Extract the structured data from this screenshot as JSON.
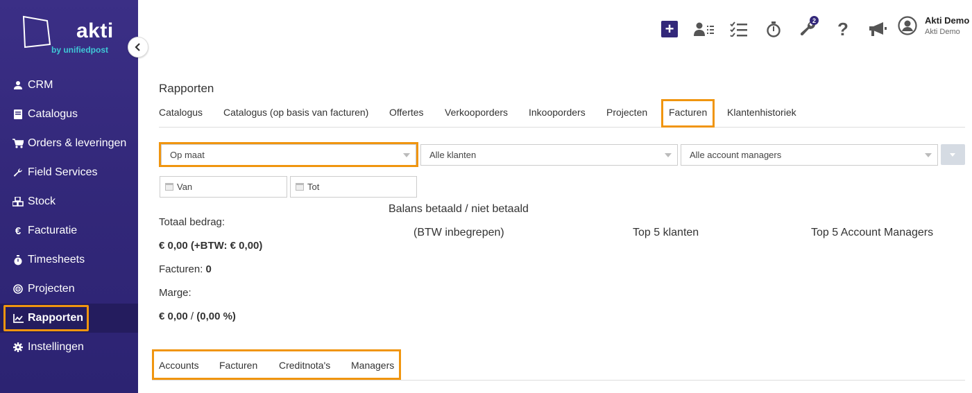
{
  "brand": {
    "name": "akti",
    "tagline": "by unifiedpost"
  },
  "sidebar": {
    "items": [
      {
        "label": "CRM",
        "icon": "user-icon"
      },
      {
        "label": "Catalogus",
        "icon": "book-icon"
      },
      {
        "label": "Orders & leveringen",
        "icon": "cart-icon"
      },
      {
        "label": "Field Services",
        "icon": "wrench-icon"
      },
      {
        "label": "Stock",
        "icon": "boxes-icon"
      },
      {
        "label": "Facturatie",
        "icon": "euro-icon"
      },
      {
        "label": "Timesheets",
        "icon": "stopwatch-icon"
      },
      {
        "label": "Projecten",
        "icon": "target-icon"
      },
      {
        "label": "Rapporten",
        "icon": "chart-line-icon",
        "active": true
      },
      {
        "label": "Instellingen",
        "icon": "gear-icon"
      }
    ]
  },
  "topbar": {
    "badge_count": "2",
    "user_name": "Akti Demo",
    "user_company": "Akti Demo"
  },
  "page": {
    "title": "Rapporten",
    "tabs": [
      "Catalogus",
      "Catalogus (op basis van facturen)",
      "Offertes",
      "Verkooporders",
      "Inkooporders",
      "Projecten",
      "Facturen",
      "Klantenhistoriek"
    ],
    "active_tab": "Facturen"
  },
  "filters": {
    "period": "Op maat",
    "customers": "Alle klanten",
    "account_managers": "Alle account managers",
    "date_from_placeholder": "Van",
    "date_to_placeholder": "Tot"
  },
  "stats": {
    "total_label": "Totaal bedrag:",
    "total_value": "€ 0,00 (+BTW: € 0,00)",
    "invoices_label": "Facturen:",
    "invoices_value": "0",
    "margin_label": "Marge:",
    "margin_value": "€ 0,00",
    "margin_sep": " / ",
    "margin_pct": "(0,00 %)"
  },
  "charts": {
    "balance_title_1": "Balans betaald / niet betaald",
    "balance_title_2": "(BTW inbegrepen)",
    "top_customers": "Top 5 klanten",
    "top_managers": "Top 5 Account Managers"
  },
  "subtabs": [
    "Accounts",
    "Facturen",
    "Creditnota's",
    "Managers"
  ],
  "colors": {
    "sidebar": "#33287a",
    "highlight": "#f0950f",
    "accent_teal": "#3fc8d6"
  }
}
